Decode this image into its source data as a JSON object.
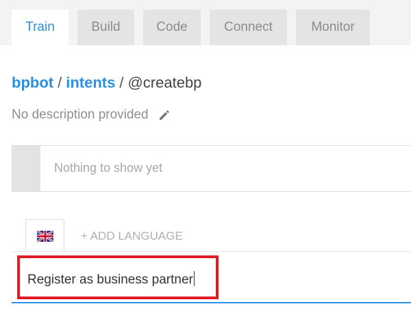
{
  "tabs": [
    {
      "label": "Train",
      "active": true
    },
    {
      "label": "Build",
      "active": false
    },
    {
      "label": "Code",
      "active": false
    },
    {
      "label": "Connect",
      "active": false
    },
    {
      "label": "Monitor",
      "active": false
    }
  ],
  "breadcrumb": {
    "bot": "bpbot",
    "section": "intents",
    "separator": "/",
    "current": "@createbp"
  },
  "description": {
    "text": "No description provided",
    "edit_icon": "pencil-icon"
  },
  "examples_box": {
    "empty_text": "Nothing to show yet"
  },
  "languages": {
    "current_flag": "uk-flag-icon",
    "add_label": "+ ADD LANGUAGE"
  },
  "expression_input": {
    "value": "Register as business partner"
  },
  "colors": {
    "accent": "#2b8fe0",
    "highlight": "#e21c24",
    "tab_bg": "#e4e4e4"
  }
}
